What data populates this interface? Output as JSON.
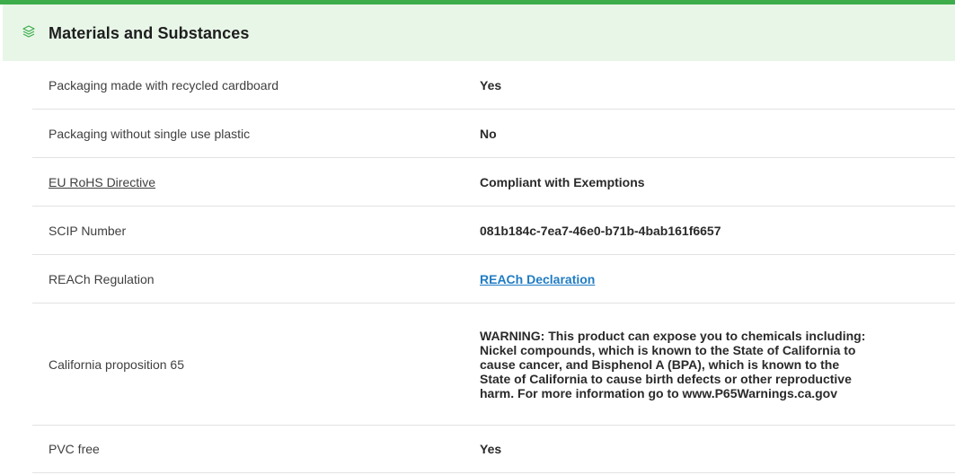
{
  "section": {
    "title": "Materials and Substances",
    "icon": "layers-leaf-icon",
    "accent_color": "#3dad4b",
    "header_bg": "#e8f6e8",
    "link_color": "#1f7cc4"
  },
  "rows": [
    {
      "label": "Packaging made with recycled cardboard",
      "value": "Yes"
    },
    {
      "label": "Packaging without single use plastic",
      "value": "No"
    },
    {
      "label": "EU RoHS Directive",
      "value": "Compliant with Exemptions"
    },
    {
      "label": "SCIP Number",
      "value": "081b184c-7ea7-46e0-b71b-4bab161f6657"
    },
    {
      "label": "REACh Regulation",
      "value": "REACh Declaration"
    },
    {
      "label": "California proposition 65",
      "value": "WARNING: This product can expose you to chemicals including: Nickel compounds, which is known to the State of California to cause cancer, and Bisphenol A (BPA), which is known to the State of California to cause birth defects or other reproductive harm. For more information go to www.P65Warnings.ca.gov"
    },
    {
      "label": "PVC free",
      "value": "Yes"
    }
  ]
}
